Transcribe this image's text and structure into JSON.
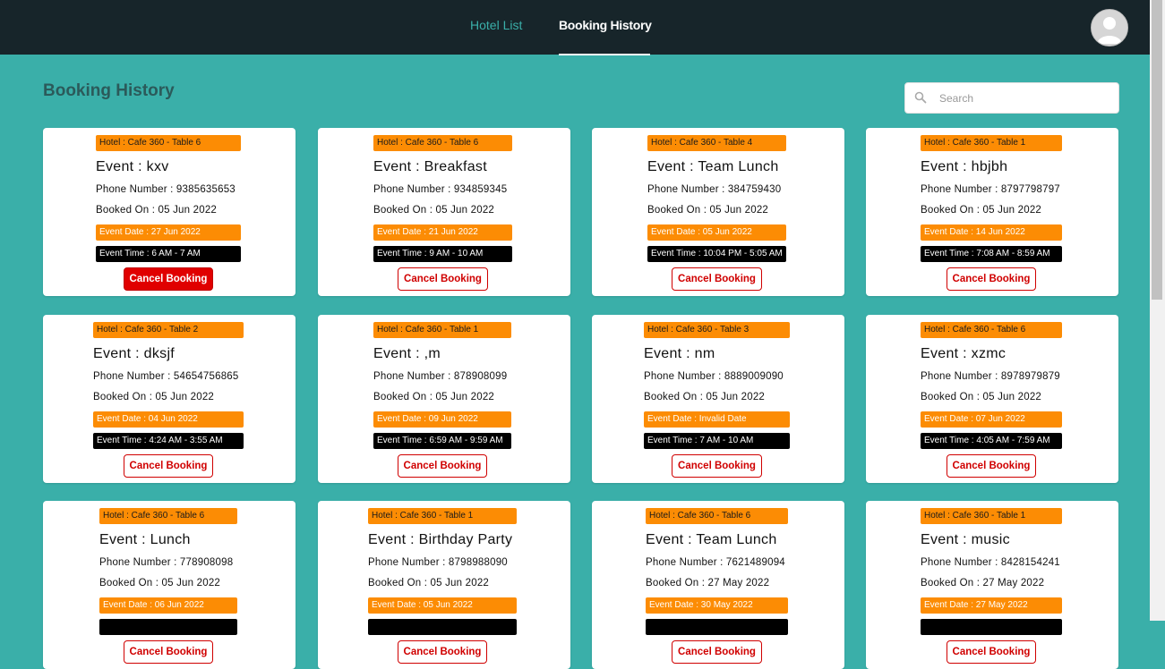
{
  "nav": {
    "hotel_list": "Hotel List",
    "booking_history": "Booking History"
  },
  "page": {
    "title": "Booking History",
    "search_placeholder": "Search"
  },
  "labels": {
    "cancel": "Cancel Booking"
  },
  "colors": {
    "background": "#3aafa9",
    "topbar": "#17252a",
    "tag": "#fc8c04",
    "cancel": "#d00000"
  },
  "bookings": [
    {
      "hotel": "Hotel : Cafe 360 - Table 6",
      "event": "Event : kxv",
      "phone": "Phone Number : 9385635653",
      "booked": "Booked On : 05 Jun 2022",
      "date": "Event Date : 27 Jun 2022",
      "time": "Event Time : 6 AM - 7 AM"
    },
    {
      "hotel": "Hotel : Cafe 360 - Table 6",
      "event": "Event : Breakfast",
      "phone": "Phone Number : 934859345",
      "booked": "Booked On : 05 Jun 2022",
      "date": "Event Date : 21 Jun 2022",
      "time": "Event Time : 9 AM - 10 AM"
    },
    {
      "hotel": "Hotel : Cafe 360 - Table 4",
      "event": "Event : Team Lunch",
      "phone": "Phone Number : 384759430",
      "booked": "Booked On : 05 Jun 2022",
      "date": "Event Date : 05 Jun 2022",
      "time": "Event Time : 10:04 PM - 5:05 AM"
    },
    {
      "hotel": "Hotel : Cafe 360 - Table 1",
      "event": "Event : hbjbh",
      "phone": "Phone Number : 8797798797",
      "booked": "Booked On : 05 Jun 2022",
      "date": "Event Date : 14 Jun 2022",
      "time": "Event Time : 7:08 AM - 8:59 AM"
    },
    {
      "hotel": "Hotel : Cafe 360 - Table 2",
      "event": "Event : dksjf",
      "phone": "Phone Number : 54654756865",
      "booked": "Booked On : 05 Jun 2022",
      "date": "Event Date : 04 Jun 2022",
      "time": "Event Time : 4:24 AM - 3:55 AM"
    },
    {
      "hotel": "Hotel : Cafe 360 - Table 1",
      "event": "Event : ,m",
      "phone": "Phone Number : 878908099",
      "booked": "Booked On : 05 Jun 2022",
      "date": "Event Date : 09 Jun 2022",
      "time": "Event Time : 6:59 AM - 9:59 AM"
    },
    {
      "hotel": "Hotel : Cafe 360 - Table 3",
      "event": "Event : nm",
      "phone": "Phone Number : 8889009090",
      "booked": "Booked On : 05 Jun 2022",
      "date": "Event Date : Invalid Date",
      "time": "Event Time : 7 AM - 10 AM"
    },
    {
      "hotel": "Hotel : Cafe 360 - Table 6",
      "event": "Event : xzmc",
      "phone": "Phone Number : 8978979879",
      "booked": "Booked On : 05 Jun 2022",
      "date": "Event Date : 07 Jun 2022",
      "time": "Event Time : 4:05 AM - 7:59 AM"
    },
    {
      "hotel": "Hotel : Cafe 360 - Table 6",
      "event": "Event : Lunch",
      "phone": "Phone Number : 778908098",
      "booked": "Booked On : 05 Jun 2022",
      "date": "Event Date : 06 Jun 2022",
      "time": ""
    },
    {
      "hotel": "Hotel : Cafe 360 - Table 1",
      "event": "Event : Birthday Party",
      "phone": "Phone Number : 8798988090",
      "booked": "Booked On : 05 Jun 2022",
      "date": "Event Date : 05 Jun 2022",
      "time": ""
    },
    {
      "hotel": "Hotel : Cafe 360 - Table 6",
      "event": "Event : Team Lunch",
      "phone": "Phone Number : 7621489094",
      "booked": "Booked On : 27 May 2022",
      "date": "Event Date : 30 May 2022",
      "time": ""
    },
    {
      "hotel": "Hotel : Cafe 360 - Table 1",
      "event": "Event : music",
      "phone": "Phone Number : 8428154241",
      "booked": "Booked On : 27 May 2022",
      "date": "Event Date : 27 May 2022",
      "time": ""
    }
  ]
}
